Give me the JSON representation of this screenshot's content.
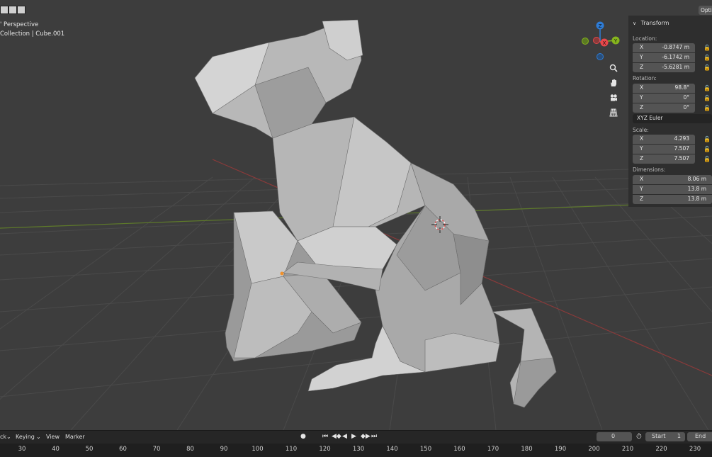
{
  "viewport": {
    "view_label": "User Perspective",
    "view_label_visible": "' Perspective",
    "collection_label": "Collection | Cube.001"
  },
  "gizmo": {
    "axes": [
      {
        "name": "Z",
        "color": "#2e7cd6"
      },
      {
        "name": "X",
        "color": "#e8474a"
      },
      {
        "name": "Y",
        "color": "#86b51d"
      }
    ]
  },
  "nav_buttons": [
    "zoom-icon",
    "hand-pan-icon",
    "camera-icon",
    "grid-perspective-icon"
  ],
  "npanel": {
    "options_label": "Opti",
    "section_title": "Transform",
    "location_label": "Location:",
    "location": [
      {
        "axis": "X",
        "value": "-0.8747 m"
      },
      {
        "axis": "Y",
        "value": "-6.1742 m"
      },
      {
        "axis": "Z",
        "value": "-5.6281 m"
      }
    ],
    "rotation_label": "Rotation:",
    "rotation": [
      {
        "axis": "X",
        "value": "98.8°"
      },
      {
        "axis": "Y",
        "value": "0°"
      },
      {
        "axis": "Z",
        "value": "0°"
      }
    ],
    "rotation_mode": "XYZ Euler",
    "scale_label": "Scale:",
    "scale": [
      {
        "axis": "X",
        "value": "4.293"
      },
      {
        "axis": "Y",
        "value": "7.507"
      },
      {
        "axis": "Z",
        "value": "7.507"
      }
    ],
    "dimensions_label": "Dimensions:",
    "dimensions": [
      {
        "axis": "X",
        "value": "8.06 m"
      },
      {
        "axis": "Y",
        "value": "13.8 m"
      },
      {
        "axis": "Z",
        "value": "13.8 m"
      }
    ]
  },
  "timeline": {
    "menus": [
      "ck",
      "Keying",
      "View",
      "Marker"
    ],
    "current_frame": "0",
    "start_label": "Start",
    "start_value": "1",
    "end_label": "End",
    "ruler_ticks": [
      "30",
      "40",
      "50",
      "60",
      "70",
      "80",
      "90",
      "100",
      "110",
      "120",
      "130",
      "140",
      "150",
      "160",
      "170",
      "180",
      "190",
      "200",
      "210",
      "220",
      "230"
    ]
  }
}
